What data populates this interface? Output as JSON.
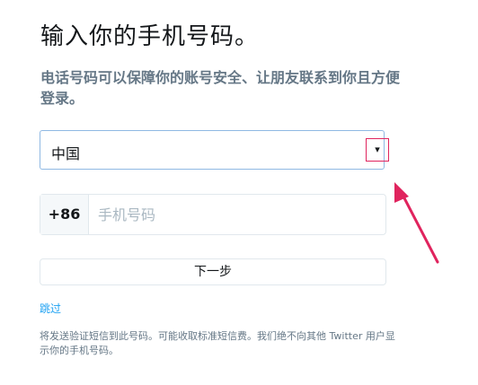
{
  "header": {
    "title": "输入你的手机号码。",
    "subtitle": "电话号码可以保障你的账号安全、让朋友联系到你且方便登录。"
  },
  "country_select": {
    "selected_value": "中国",
    "arrow_glyph": "▾"
  },
  "phone": {
    "country_code": "+86",
    "placeholder": "手机号码",
    "value": ""
  },
  "actions": {
    "next_label": "下一步",
    "skip_label": "跳过"
  },
  "disclaimer": "将发送验证短信到此号码。可能收取标准短信费。我们绝不向其他 Twitter 用户显示你的手机号码。",
  "colors": {
    "annotation_red": "#e0245e",
    "link_blue": "#1da1f2",
    "focus_border": "#8fb9e3"
  }
}
